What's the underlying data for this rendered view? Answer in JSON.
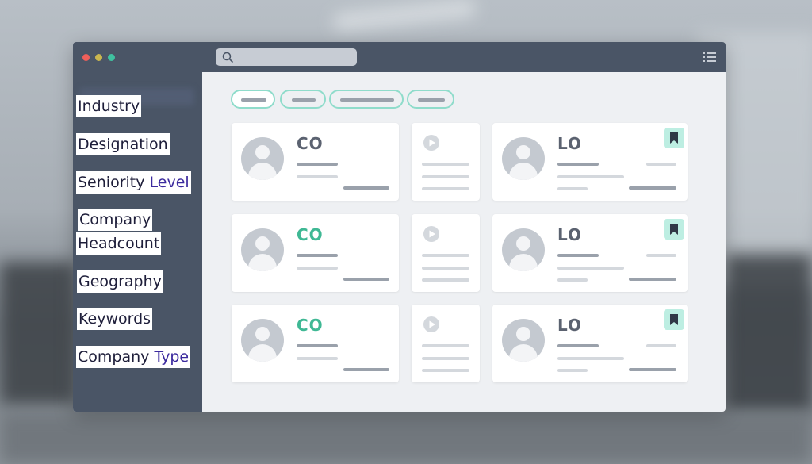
{
  "filters": {
    "industry": "Industry",
    "designation": "Designation",
    "seniority_part1": "Seniority ",
    "seniority_part2": "Level",
    "company_headcount_line1": "Company",
    "company_headcount_line2": "Headcount",
    "geography": "Geography",
    "keywords": "Keywords",
    "company_type_part1": "Company ",
    "company_type_part2": "Type"
  },
  "cards": {
    "left_logo": "CO",
    "right_logo": "LO"
  },
  "colors": {
    "titlebar": "#4a5566",
    "accent_teal": "#3fb894",
    "chip_border": "#8fdccb",
    "bookmark_bg": "#bdeee2",
    "label_accent": "#3b2a9e"
  },
  "icons": {
    "search": "search-icon",
    "menu": "list-menu-icon",
    "play": "play-icon",
    "bookmark": "bookmark-icon",
    "avatar": "user-avatar-icon"
  }
}
